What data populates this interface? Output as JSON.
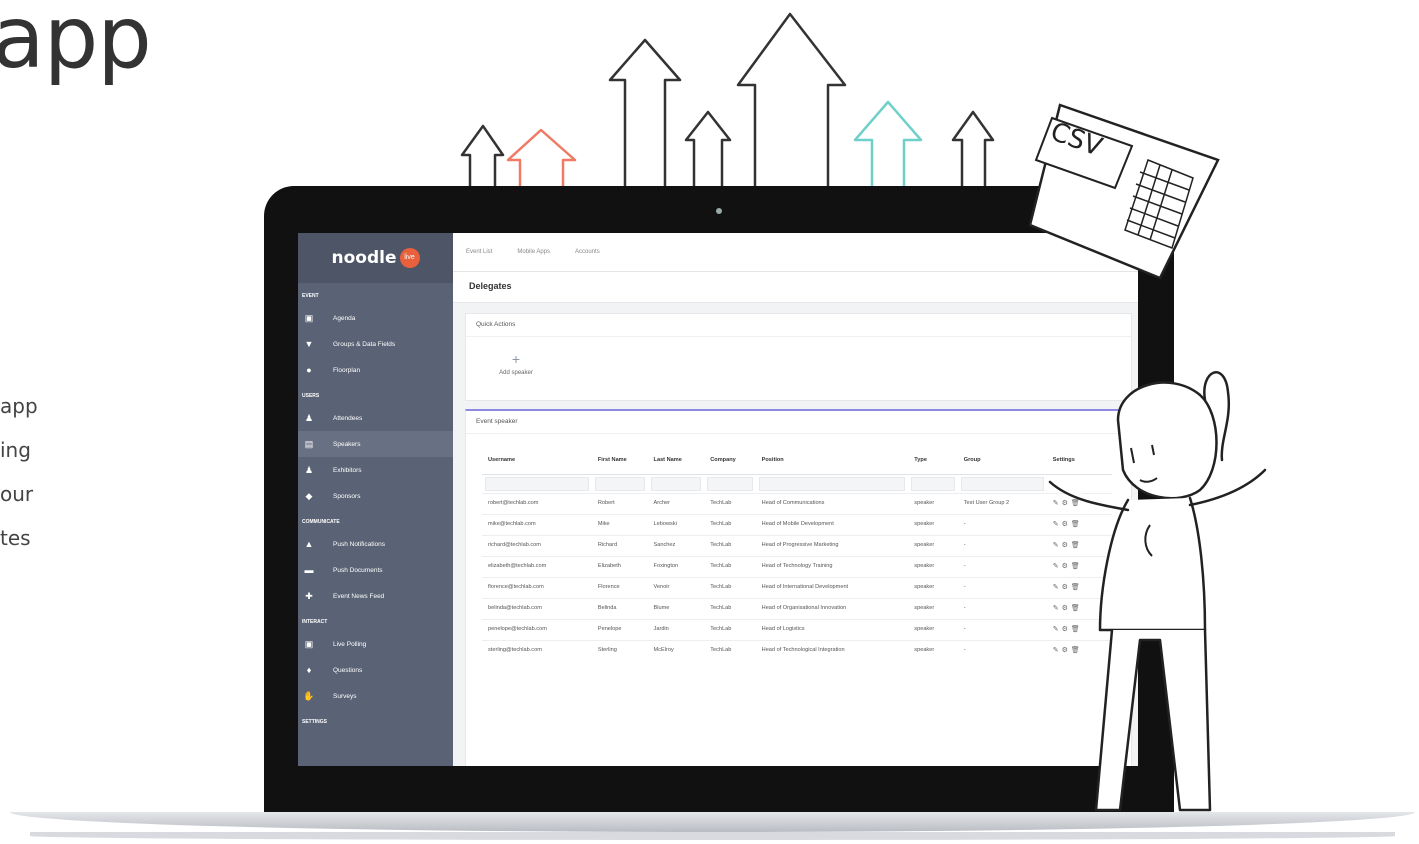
{
  "hero": {
    "title": "app",
    "lines": [
      "app",
      "ing",
      "our",
      "tes"
    ]
  },
  "sidebar": {
    "logo": "noodle",
    "logo_badge": "live",
    "sections": [
      {
        "title": "EVENT",
        "items": [
          {
            "label": "Agenda",
            "icon": "calendar-icon",
            "glyph": "▣"
          },
          {
            "label": "Groups & Data Fields",
            "icon": "filter-icon",
            "glyph": "▼"
          },
          {
            "label": "Floorplan",
            "icon": "map-pin-icon",
            "glyph": "●"
          }
        ]
      },
      {
        "title": "USERS",
        "items": [
          {
            "label": "Attendees",
            "icon": "user-icon",
            "glyph": "♟"
          },
          {
            "label": "Speakers",
            "icon": "id-card-icon",
            "glyph": "▤",
            "active": true
          },
          {
            "label": "Exhibitors",
            "icon": "users-icon",
            "glyph": "♟"
          },
          {
            "label": "Sponsors",
            "icon": "tag-icon",
            "glyph": "◆"
          }
        ]
      },
      {
        "title": "COMMUNICATE",
        "items": [
          {
            "label": "Push Notifications",
            "icon": "bell-icon",
            "glyph": "▲"
          },
          {
            "label": "Push Documents",
            "icon": "folder-icon",
            "glyph": "▬"
          },
          {
            "label": "Event News Feed",
            "icon": "pin-icon",
            "glyph": "✚"
          }
        ]
      },
      {
        "title": "INTERACT",
        "items": [
          {
            "label": "Live Polling",
            "icon": "poll-icon",
            "glyph": "▣"
          },
          {
            "label": "Questions",
            "icon": "microphone-icon",
            "glyph": "♦"
          },
          {
            "label": "Surveys",
            "icon": "thumbs-up-icon",
            "glyph": "✋"
          }
        ]
      },
      {
        "title": "SETTINGS",
        "items": []
      }
    ]
  },
  "main": {
    "tabs": [
      "Event List",
      "Mobile Apps",
      "Accounts"
    ],
    "page_title": "Delegates",
    "quick_actions": {
      "title": "Quick Actions",
      "add_label": "Add speaker",
      "plus": "+"
    },
    "table_card_title": "Event speaker",
    "columns": [
      "Username",
      "First Name",
      "Last Name",
      "Company",
      "Position",
      "Type",
      "Group",
      "Settings"
    ],
    "rows": [
      [
        "robert@techlab.com",
        "Robert",
        "Archer",
        "TechLab",
        "Head of Communications",
        "speaker",
        "Test User Group 2"
      ],
      [
        "mike@techlab.com",
        "Mike",
        "Lebowski",
        "TechLab",
        "Head of Mobile Development",
        "speaker",
        "-"
      ],
      [
        "richard@techlab.com",
        "Richard",
        "Sanchez",
        "TechLab",
        "Head of Progressive Marketing",
        "speaker",
        "-"
      ],
      [
        "elizabeth@techlab.com",
        "Elizabeth",
        "Foxington",
        "TechLab",
        "Head of Technology Training",
        "speaker",
        "-"
      ],
      [
        "florence@techlab.com",
        "Florence",
        "Venoir",
        "TechLab",
        "Head of International Development",
        "speaker",
        "-"
      ],
      [
        "belinda@techlab.com",
        "Belinda",
        "Blume",
        "TechLab",
        "Head of Organisational Innovation",
        "speaker",
        "-"
      ],
      [
        "penelope@techlab.com",
        "Penelope",
        "Jardin",
        "TechLab",
        "Head of Logistics",
        "speaker",
        "-"
      ],
      [
        "sterling@techlab.com",
        "Sterling",
        "McElroy",
        "TechLab",
        "Head of Technological Integration",
        "speaker",
        "-"
      ]
    ]
  },
  "illustration": {
    "csv_label": "CSV"
  },
  "colors": {
    "sidebar": "#5a6375",
    "accent": "#e8603c",
    "teal": "#6fd0c9",
    "coral": "#f07a63"
  }
}
